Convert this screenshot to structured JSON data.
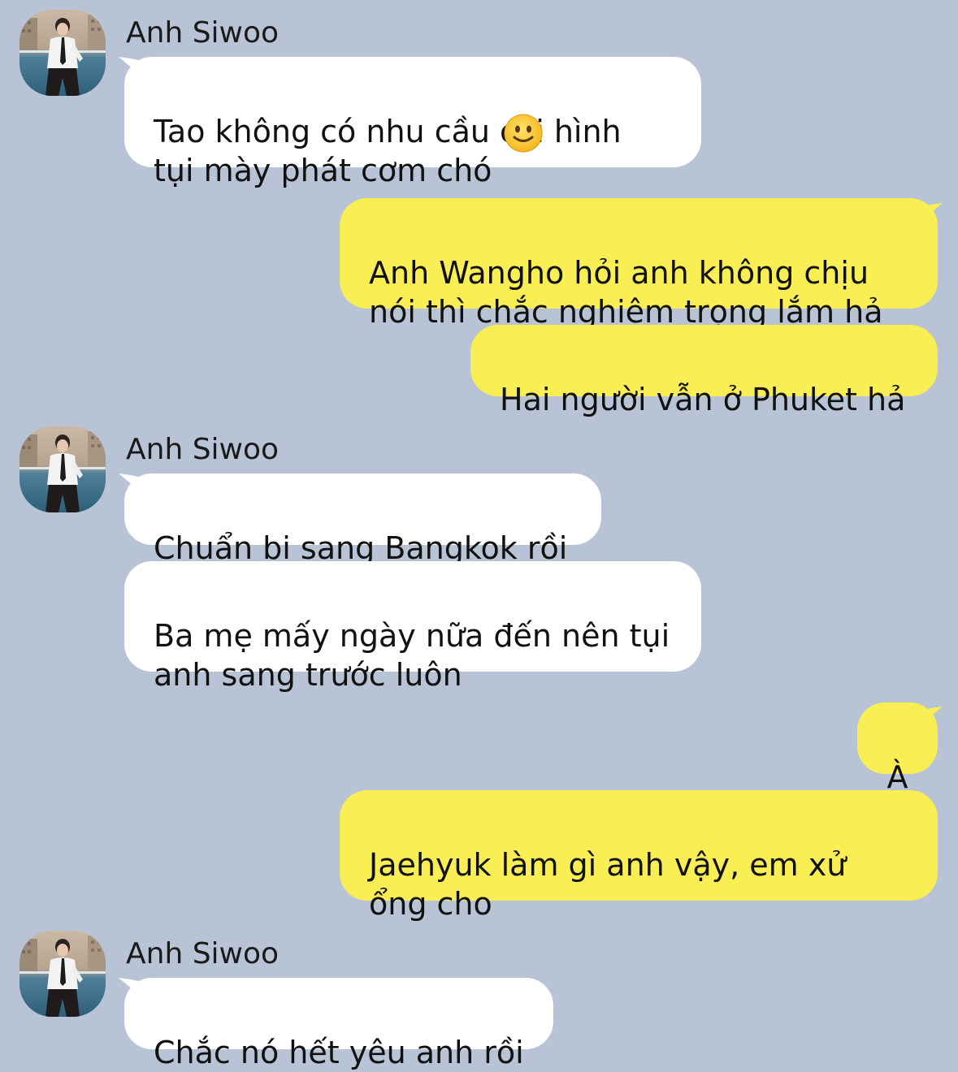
{
  "colors": {
    "background": "#b8c4d6",
    "incoming_bubble": "#ffffff",
    "outgoing_bubble": "#f9ef55"
  },
  "groups": [
    {
      "sender": "Anh Siwoo",
      "avatar": "avatar-photo",
      "messages": [
        {
          "text": "Tao không có nhu cầu coi hình\ntụi mày phát cơm chó",
          "emoji": "slightly-smiling-face-icon"
        }
      ]
    },
    {
      "messages": [
        {
          "text": "Anh Wangho hỏi anh không chịu\nnói thì chắc nghiêm trọng lắm hả"
        },
        {
          "text": "Hai người vẫn ở Phuket hả"
        }
      ]
    },
    {
      "sender": "Anh Siwoo",
      "avatar": "avatar-photo",
      "messages": [
        {
          "text": "Chuẩn bị sang Bangkok rồi"
        },
        {
          "text": "Ba mẹ mấy ngày nữa đến nên tụi\nanh sang trước luôn"
        }
      ]
    },
    {
      "messages": [
        {
          "text": "À"
        },
        {
          "text": "Jaehyuk làm gì anh vậy, em xử\nổng cho"
        }
      ]
    },
    {
      "sender": "Anh Siwoo",
      "avatar": "avatar-photo",
      "messages": [
        {
          "text": "Chắc nó hết yêu anh rồi"
        }
      ]
    }
  ]
}
